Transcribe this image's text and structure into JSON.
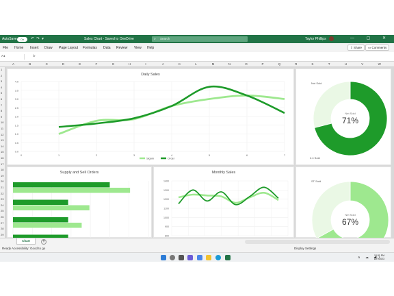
{
  "titlebar": {
    "autosave": "AutoSave",
    "autosave_state": "On",
    "doc_title": "Sales Chart - Saved to OneDrive",
    "search_placeholder": "Search",
    "user": "Taylor Phillips",
    "window_controls": "— ▢ ✕"
  },
  "menu": {
    "items": [
      "File",
      "Home",
      "Insert",
      "Draw",
      "Page Layout",
      "Formulas",
      "Data",
      "Review",
      "View",
      "Help"
    ],
    "share": "Share",
    "comments": "Comments"
  },
  "formula_bar": {
    "name_box": "A1",
    "fx": "fx"
  },
  "columns": [
    "A",
    "B",
    "C",
    "D",
    "E",
    "F",
    "G",
    "H",
    "I",
    "J",
    "K",
    "L",
    "M",
    "N",
    "O",
    "P",
    "Q",
    "R",
    "S",
    "T",
    "U",
    "V",
    "W"
  ],
  "rows": [
    "1",
    "2",
    "3",
    "4",
    "5",
    "6",
    "7",
    "8",
    "9",
    "10",
    "11",
    "12",
    "13",
    "14",
    "15",
    "16",
    "17",
    "18",
    "19",
    "20",
    "21",
    "22",
    "23",
    "24",
    "25",
    "26",
    "27",
    "28",
    "29"
  ],
  "colors": {
    "dark_green": "#1e9b2a",
    "light_green": "#9ee88f",
    "excel_green": "#217346"
  },
  "chart_data": [
    {
      "type": "line",
      "title": "Daily Sales",
      "x": [
        1,
        2,
        3,
        4,
        5,
        6,
        7
      ],
      "xlim": [
        0,
        7
      ],
      "ylim": [
        0,
        4
      ],
      "y_ticks": [
        "0.0",
        "0.5",
        "1.0",
        "1.5",
        "2.0",
        "2.5",
        "3.0",
        "3.5",
        "4.0"
      ],
      "series": [
        {
          "name": "Signin",
          "color": "#9ee88f",
          "values": [
            1.0,
            1.75,
            1.85,
            2.6,
            3.0,
            3.2,
            3.0
          ]
        },
        {
          "name": "Order",
          "color": "#1e9b2a",
          "values": [
            1.4,
            1.6,
            1.9,
            2.6,
            3.7,
            3.2,
            2.2
          ]
        }
      ],
      "legend": "bottom"
    },
    {
      "type": "bar",
      "orientation": "horizontal",
      "title": "Supply and Sell Orders",
      "series": [
        {
          "color": "#1e9b2a",
          "values": [
            100,
            57,
            57,
            57
          ]
        },
        {
          "color": "#9ee88f",
          "values": [
            121,
            79,
            71,
            60
          ]
        }
      ],
      "xlim": [
        0,
        140
      ]
    },
    {
      "type": "line",
      "title": "Monthly Sales",
      "y_ticks": [
        "800",
        "900",
        "1000",
        "1100",
        "1200",
        "1300",
        "1400"
      ],
      "ylim": [
        800,
        1400
      ],
      "series": [
        {
          "color": "#9ee88f",
          "values": [
            1220,
            1250,
            1240,
            1230,
            1160,
            1220,
            1270,
            1190
          ]
        },
        {
          "color": "#1e9b2a",
          "values": [
            1150,
            1300,
            1180,
            1280,
            1140,
            1230,
            1330,
            1210
          ]
        }
      ]
    },
    {
      "type": "pie",
      "style": "donut",
      "center_label": "Net Sold",
      "percent_label": "71%",
      "slices": [
        {
          "label": "Not Sold",
          "value": 29,
          "color": "#eaf8e5"
        },
        {
          "label": "2.4 Sold",
          "value": 71,
          "color": "#1e9b2a"
        }
      ]
    },
    {
      "type": "pie",
      "style": "donut",
      "center_label": "Net Sold",
      "percent_label": "67%",
      "slices": [
        {
          "label": "ST Sold",
          "value": 33,
          "color": "#eaf8e5"
        },
        {
          "label": "",
          "value": 67,
          "color": "#9ee88f"
        }
      ]
    }
  ],
  "sheet": {
    "tab": "Chart",
    "add": "+"
  },
  "status": {
    "left": "Ready   Accessibility: Good to go",
    "right": "Display Settings"
  },
  "taskbar": {
    "time": "10:21 PM",
    "date": "11/7/2023",
    "tray": "∧ ☁ ◀)"
  }
}
